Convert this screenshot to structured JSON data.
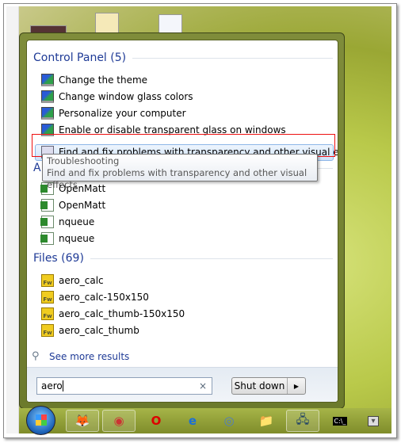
{
  "control_panel": {
    "header": "Control Panel (5)",
    "items": [
      {
        "label": "Change the theme",
        "icon": "personalization-icon"
      },
      {
        "label": "Change window glass colors",
        "icon": "personalization-icon"
      },
      {
        "label": "Personalize your computer",
        "icon": "personalization-icon"
      },
      {
        "label": "Enable or disable transparent glass on windows",
        "icon": "personalization-icon"
      },
      {
        "label": "Find and fix problems with transparency and other visual effects",
        "icon": "troubleshoot-icon",
        "highlighted": true
      }
    ]
  },
  "tooltip": {
    "title": "Troubleshooting",
    "text": "Find and fix problems with transparency and other visual effects"
  },
  "programs": {
    "header": "A",
    "items": [
      {
        "label": "OpenMatt",
        "icon": "excel-icon"
      },
      {
        "label": "OpenMatt",
        "icon": "excel-icon"
      },
      {
        "label": "nqueue",
        "icon": "excel-icon"
      },
      {
        "label": "nqueue",
        "icon": "excel-icon"
      }
    ]
  },
  "files": {
    "header": "Files (69)",
    "items": [
      {
        "label": "aero_calc",
        "icon": "fireworks-icon"
      },
      {
        "label": "aero_calc-150x150",
        "icon": "fireworks-icon"
      },
      {
        "label": "aero_calc_thumb-150x150",
        "icon": "fireworks-icon"
      },
      {
        "label": "aero_calc_thumb",
        "icon": "fireworks-icon"
      }
    ]
  },
  "fw_badge": "Fw",
  "see_more": "See more results",
  "search": {
    "value": "aero",
    "clear": "×"
  },
  "shutdown": {
    "label": "Shut down",
    "arrow": "▶"
  },
  "taskbar": [
    {
      "name": "firefox",
      "glyph": "🦊"
    },
    {
      "name": "chrome",
      "glyph": "◉"
    },
    {
      "name": "opera",
      "glyph": "O"
    },
    {
      "name": "internet-explorer",
      "glyph": "e"
    },
    {
      "name": "safari",
      "glyph": "◎"
    },
    {
      "name": "explorer",
      "glyph": "📁"
    },
    {
      "name": "network",
      "glyph": "🖧"
    },
    {
      "name": "cmd",
      "glyph": "C:\\_"
    },
    {
      "name": "show-hidden",
      "glyph": "▾"
    }
  ],
  "colors": {
    "header": "#1e3a96",
    "highlight_border": "#8db6e8",
    "annotation": "#e11111"
  }
}
